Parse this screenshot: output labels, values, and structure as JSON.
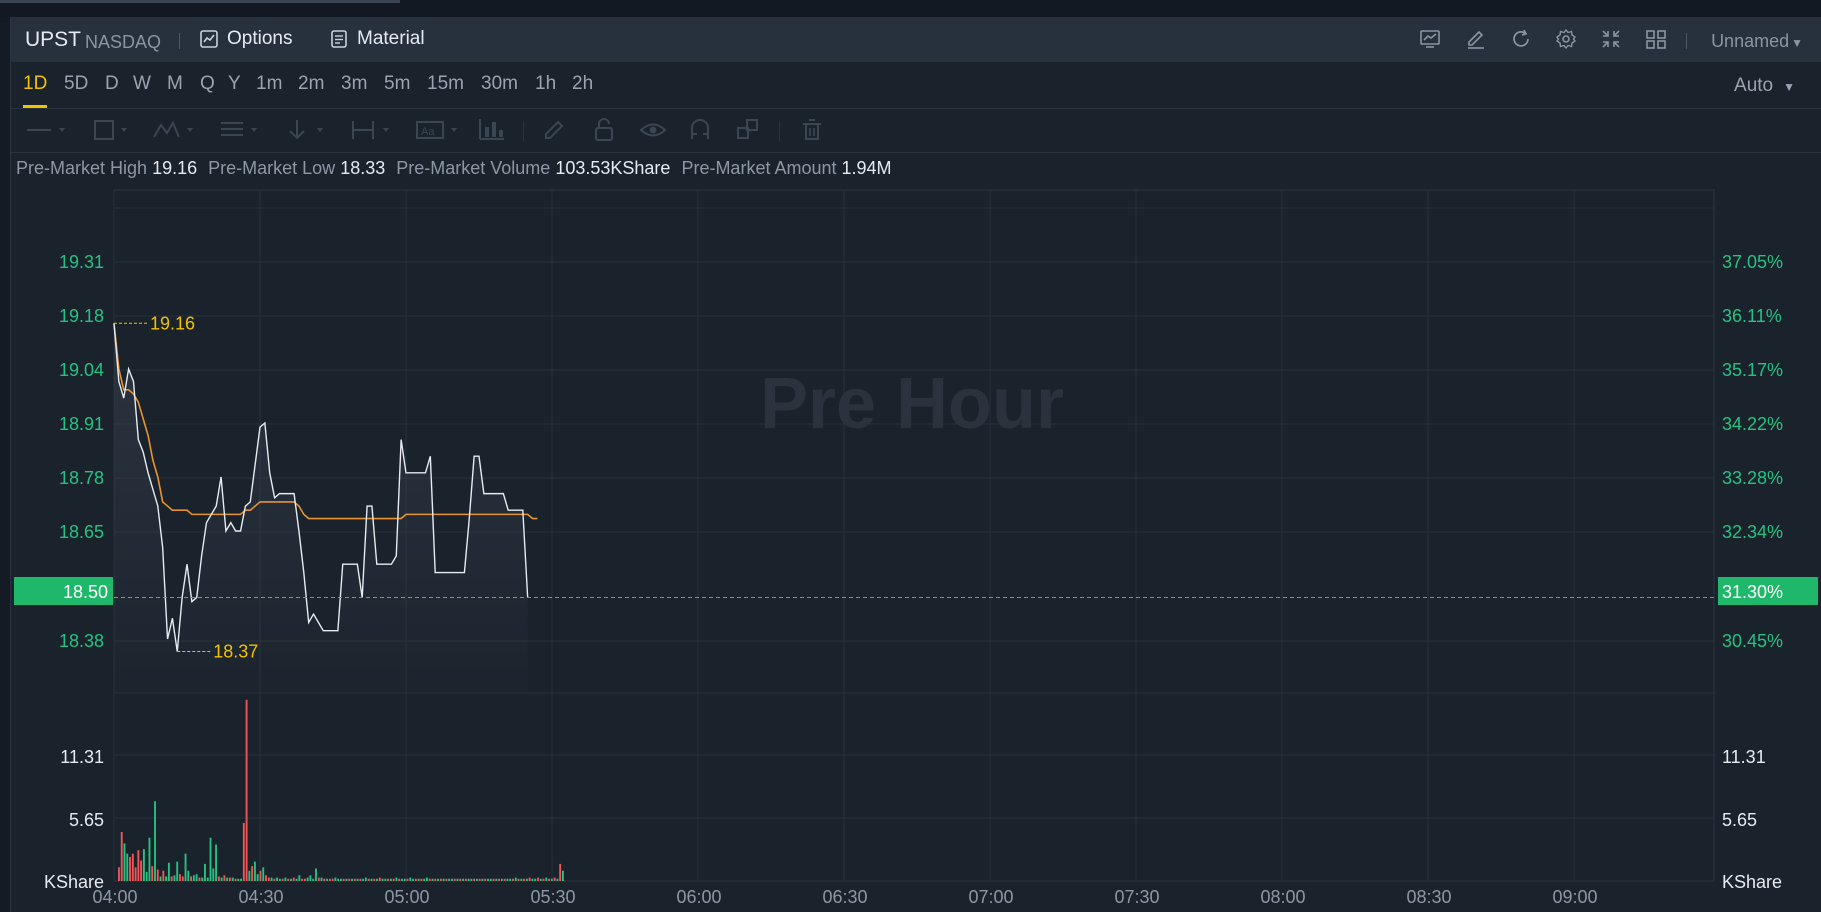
{
  "header": {
    "symbol": "UPST",
    "exchange": "NASDAQ",
    "options_label": "Options",
    "material_label": "Material",
    "workspace_label": "Unnamed"
  },
  "timeframes": [
    "1D",
    "5D",
    "D",
    "W",
    "M",
    "Q",
    "Y",
    "1m",
    "2m",
    "3m",
    "5m",
    "15m",
    "30m",
    "1h",
    "2h"
  ],
  "active_timeframe": "1D",
  "scale_mode": "Auto",
  "info": {
    "high_label": "Pre-Market High",
    "high_value": "19.16",
    "low_label": "Pre-Market Low",
    "low_value": "18.33",
    "volume_label": "Pre-Market Volume",
    "volume_value": "103.53KShare",
    "amount_label": "Pre-Market Amount",
    "amount_value": "1.94M"
  },
  "watermark": "Pre Hour",
  "colors": {
    "up": "#26c281",
    "down": "#f15656",
    "price_line": "#e6ebf1",
    "avg_line": "#e8932f",
    "highlight": "#f2c200",
    "current_bg": "#1fb86b"
  },
  "chart_data": {
    "type": "line",
    "price_axis_left": [
      "19.31",
      "19.18",
      "19.04",
      "18.91",
      "18.78",
      "18.65",
      "18.38"
    ],
    "price_axis_right": [
      "37.05%",
      "36.11%",
      "35.17%",
      "34.22%",
      "33.28%",
      "32.34%",
      "30.45%"
    ],
    "current_price": "18.50",
    "current_change": "31.30%",
    "high_marker": "19.16",
    "low_marker": "18.37",
    "volume_axis": [
      "11.31",
      "5.65"
    ],
    "volume_unit": "KShare",
    "x_ticks": [
      "04:00",
      "04:30",
      "05:00",
      "05:30",
      "06:00",
      "06:30",
      "07:00",
      "07:30",
      "08:00",
      "08:30",
      "09:00"
    ],
    "price_ylim": [
      18.27,
      19.44
    ],
    "price": [
      [
        0,
        19.16
      ],
      [
        1,
        19.02
      ],
      [
        2,
        18.98
      ],
      [
        3,
        19.05
      ],
      [
        4,
        19.02
      ],
      [
        5,
        18.88
      ],
      [
        6,
        18.85
      ],
      [
        7,
        18.8
      ],
      [
        8,
        18.76
      ],
      [
        9,
        18.72
      ],
      [
        10,
        18.62
      ],
      [
        11,
        18.4
      ],
      [
        12,
        18.45
      ],
      [
        13,
        18.37
      ],
      [
        14,
        18.5
      ],
      [
        15,
        18.58
      ],
      [
        16,
        18.49
      ],
      [
        17,
        18.5
      ],
      [
        18,
        18.6
      ],
      [
        19,
        18.68
      ],
      [
        20,
        18.7
      ],
      [
        21,
        18.72
      ],
      [
        22,
        18.79
      ],
      [
        23,
        18.66
      ],
      [
        24,
        18.68
      ],
      [
        25,
        18.66
      ],
      [
        26,
        18.66
      ],
      [
        27,
        18.72
      ],
      [
        28,
        18.73
      ],
      [
        29,
        18.82
      ],
      [
        30,
        18.91
      ],
      [
        31,
        18.92
      ],
      [
        32,
        18.8
      ],
      [
        33,
        18.74
      ],
      [
        34,
        18.75
      ],
      [
        35,
        18.75
      ],
      [
        36,
        18.75
      ],
      [
        37,
        18.75
      ],
      [
        38,
        18.66
      ],
      [
        39,
        18.56
      ],
      [
        40,
        18.44
      ],
      [
        41,
        18.46
      ],
      [
        42,
        18.44
      ],
      [
        43,
        18.42
      ],
      [
        44,
        18.42
      ],
      [
        45,
        18.42
      ],
      [
        46,
        18.42
      ],
      [
        47,
        18.58
      ],
      [
        48,
        18.58
      ],
      [
        49,
        18.58
      ],
      [
        50,
        18.58
      ],
      [
        51,
        18.5
      ],
      [
        52,
        18.72
      ],
      [
        53,
        18.72
      ],
      [
        54,
        18.58
      ],
      [
        55,
        18.58
      ],
      [
        56,
        18.58
      ],
      [
        57,
        18.58
      ],
      [
        58,
        18.6
      ],
      [
        59,
        18.88
      ],
      [
        60,
        18.8
      ],
      [
        61,
        18.8
      ],
      [
        62,
        18.8
      ],
      [
        63,
        18.8
      ],
      [
        64,
        18.8
      ],
      [
        65,
        18.84
      ],
      [
        66,
        18.56
      ],
      [
        67,
        18.56
      ],
      [
        68,
        18.56
      ],
      [
        69,
        18.56
      ],
      [
        70,
        18.56
      ],
      [
        71,
        18.56
      ],
      [
        72,
        18.56
      ],
      [
        73,
        18.69
      ],
      [
        74,
        18.84
      ],
      [
        75,
        18.84
      ],
      [
        76,
        18.75
      ],
      [
        77,
        18.75
      ],
      [
        78,
        18.75
      ],
      [
        79,
        18.75
      ],
      [
        80,
        18.75
      ],
      [
        81,
        18.71
      ],
      [
        82,
        18.71
      ],
      [
        83,
        18.71
      ],
      [
        84,
        18.71
      ],
      [
        85,
        18.5
      ]
    ],
    "avg_price": [
      [
        0,
        19.16
      ],
      [
        1,
        19.05
      ],
      [
        2,
        19.0
      ],
      [
        3,
        19.0
      ],
      [
        4,
        18.99
      ],
      [
        5,
        18.97
      ],
      [
        6,
        18.93
      ],
      [
        7,
        18.89
      ],
      [
        8,
        18.83
      ],
      [
        9,
        18.79
      ],
      [
        10,
        18.73
      ],
      [
        11,
        18.72
      ],
      [
        12,
        18.71
      ],
      [
        13,
        18.71
      ],
      [
        14,
        18.71
      ],
      [
        15,
        18.71
      ],
      [
        16,
        18.7
      ],
      [
        17,
        18.7
      ],
      [
        18,
        18.7
      ],
      [
        19,
        18.7
      ],
      [
        20,
        18.7
      ],
      [
        21,
        18.7
      ],
      [
        22,
        18.7
      ],
      [
        23,
        18.7
      ],
      [
        24,
        18.7
      ],
      [
        25,
        18.7
      ],
      [
        26,
        18.7
      ],
      [
        27,
        18.71
      ],
      [
        28,
        18.71
      ],
      [
        29,
        18.72
      ],
      [
        30,
        18.73
      ],
      [
        31,
        18.73
      ],
      [
        32,
        18.73
      ],
      [
        33,
        18.73
      ],
      [
        34,
        18.73
      ],
      [
        35,
        18.73
      ],
      [
        36,
        18.73
      ],
      [
        37,
        18.73
      ],
      [
        38,
        18.72
      ],
      [
        39,
        18.7
      ],
      [
        40,
        18.69
      ],
      [
        41,
        18.69
      ],
      [
        42,
        18.69
      ],
      [
        43,
        18.69
      ],
      [
        44,
        18.69
      ],
      [
        45,
        18.69
      ],
      [
        46,
        18.69
      ],
      [
        47,
        18.69
      ],
      [
        48,
        18.69
      ],
      [
        49,
        18.69
      ],
      [
        50,
        18.69
      ],
      [
        51,
        18.69
      ],
      [
        52,
        18.69
      ],
      [
        53,
        18.69
      ],
      [
        54,
        18.69
      ],
      [
        55,
        18.69
      ],
      [
        56,
        18.69
      ],
      [
        57,
        18.69
      ],
      [
        58,
        18.69
      ],
      [
        59,
        18.69
      ],
      [
        60,
        18.7
      ],
      [
        61,
        18.7
      ],
      [
        62,
        18.7
      ],
      [
        63,
        18.7
      ],
      [
        64,
        18.7
      ],
      [
        65,
        18.7
      ],
      [
        66,
        18.7
      ],
      [
        67,
        18.7
      ],
      [
        68,
        18.7
      ],
      [
        69,
        18.7
      ],
      [
        70,
        18.7
      ],
      [
        71,
        18.7
      ],
      [
        72,
        18.7
      ],
      [
        73,
        18.7
      ],
      [
        74,
        18.7
      ],
      [
        75,
        18.7
      ],
      [
        76,
        18.7
      ],
      [
        77,
        18.7
      ],
      [
        78,
        18.7
      ],
      [
        79,
        18.7
      ],
      [
        80,
        18.7
      ],
      [
        81,
        18.7
      ],
      [
        82,
        18.7
      ],
      [
        83,
        18.7
      ],
      [
        84,
        18.7
      ],
      [
        85,
        18.7
      ],
      [
        86,
        18.69
      ],
      [
        87,
        18.69
      ]
    ],
    "volume_ylim": [
      0,
      16.5
    ],
    "volume": [
      [
        0,
        1.2,
        "down"
      ],
      [
        1,
        4.3,
        "down"
      ],
      [
        2,
        3.3,
        "up"
      ],
      [
        3,
        2.4,
        "up"
      ],
      [
        4,
        2.1,
        "down"
      ],
      [
        5,
        2.4,
        "down"
      ],
      [
        6,
        1.2,
        "down"
      ],
      [
        7,
        2.7,
        "down"
      ],
      [
        8,
        1.8,
        "down"
      ],
      [
        9,
        2.8,
        "up"
      ],
      [
        10,
        0.8,
        "up"
      ],
      [
        11,
        3.8,
        "up"
      ],
      [
        12,
        1.3,
        "down"
      ],
      [
        13,
        7.0,
        "up"
      ],
      [
        14,
        1.0,
        "down"
      ],
      [
        15,
        0.4,
        "up"
      ],
      [
        16,
        0.9,
        "down"
      ],
      [
        17,
        0.4,
        "up"
      ],
      [
        18,
        1.6,
        "up"
      ],
      [
        19,
        0.4,
        "down"
      ],
      [
        20,
        0.5,
        "up"
      ],
      [
        21,
        1.7,
        "up"
      ],
      [
        22,
        0.6,
        "down"
      ],
      [
        23,
        0.4,
        "down"
      ],
      [
        24,
        2.4,
        "up"
      ],
      [
        25,
        0.9,
        "up"
      ],
      [
        26,
        0.4,
        "down"
      ],
      [
        27,
        0.5,
        "up"
      ],
      [
        28,
        0.6,
        "up"
      ],
      [
        29,
        0.3,
        "down"
      ],
      [
        30,
        0.3,
        "up"
      ],
      [
        31,
        1.5,
        "up"
      ],
      [
        32,
        0.3,
        "up"
      ],
      [
        33,
        3.8,
        "up"
      ],
      [
        34,
        1.1,
        "up"
      ],
      [
        35,
        3.2,
        "up"
      ],
      [
        36,
        0.4,
        "down"
      ],
      [
        37,
        0.3,
        "up"
      ],
      [
        38,
        0.5,
        "down"
      ],
      [
        39,
        0.3,
        "up"
      ],
      [
        40,
        0.3,
        "down"
      ],
      [
        41,
        0.3,
        "up"
      ],
      [
        42,
        0.2,
        "down"
      ],
      [
        43,
        0.2,
        "up"
      ],
      [
        44,
        0.2,
        "up"
      ],
      [
        45,
        5.1,
        "down"
      ],
      [
        46,
        15.9,
        "down"
      ],
      [
        47,
        0.9,
        "up"
      ],
      [
        48,
        1.3,
        "down"
      ],
      [
        49,
        1.7,
        "up"
      ],
      [
        50,
        0.6,
        "up"
      ],
      [
        51,
        0.9,
        "down"
      ],
      [
        52,
        1.2,
        "up"
      ],
      [
        53,
        0.5,
        "down"
      ],
      [
        54,
        0.3,
        "down"
      ],
      [
        55,
        0.3,
        "up"
      ],
      [
        56,
        0.2,
        "down"
      ],
      [
        57,
        0.3,
        "up"
      ],
      [
        58,
        0.2,
        "up"
      ],
      [
        59,
        0.2,
        "down"
      ],
      [
        60,
        0.3,
        "up"
      ],
      [
        61,
        0.2,
        "down"
      ],
      [
        62,
        0.2,
        "up"
      ],
      [
        63,
        0.3,
        "down"
      ],
      [
        64,
        0.2,
        "up"
      ],
      [
        65,
        0.5,
        "up"
      ],
      [
        66,
        0.2,
        "down"
      ],
      [
        67,
        0.2,
        "down"
      ],
      [
        68,
        0.3,
        "up"
      ],
      [
        69,
        0.5,
        "up"
      ],
      [
        70,
        0.2,
        "up"
      ],
      [
        71,
        1.1,
        "up"
      ],
      [
        72,
        0.3,
        "down"
      ],
      [
        73,
        0.3,
        "up"
      ],
      [
        74,
        0.2,
        "down"
      ],
      [
        75,
        0.2,
        "up"
      ],
      [
        76,
        0.2,
        "down"
      ],
      [
        77,
        0.2,
        "down"
      ],
      [
        78,
        0.3,
        "up"
      ],
      [
        79,
        0.2,
        "up"
      ],
      [
        80,
        0.2,
        "up"
      ],
      [
        81,
        0.2,
        "down"
      ],
      [
        82,
        0.2,
        "up"
      ],
      [
        83,
        0.2,
        "down"
      ],
      [
        84,
        0.2,
        "up"
      ],
      [
        85,
        0.2,
        "down"
      ],
      [
        86,
        0.2,
        "up"
      ],
      [
        87,
        0.2,
        "down"
      ],
      [
        88,
        0.2,
        "up"
      ],
      [
        89,
        0.3,
        "up"
      ],
      [
        90,
        0.2,
        "down"
      ],
      [
        91,
        0.2,
        "up"
      ],
      [
        92,
        0.2,
        "down"
      ],
      [
        93,
        0.2,
        "up"
      ],
      [
        94,
        0.3,
        "down"
      ],
      [
        95,
        0.2,
        "up"
      ],
      [
        96,
        0.2,
        "up"
      ],
      [
        97,
        0.2,
        "down"
      ],
      [
        98,
        0.2,
        "up"
      ],
      [
        99,
        0.2,
        "down"
      ],
      [
        100,
        0.3,
        "up"
      ],
      [
        101,
        0.2,
        "down"
      ],
      [
        102,
        0.2,
        "up"
      ],
      [
        103,
        0.2,
        "up"
      ],
      [
        104,
        0.2,
        "down"
      ],
      [
        105,
        0.3,
        "up"
      ],
      [
        106,
        0.2,
        "up"
      ],
      [
        107,
        0.2,
        "down"
      ],
      [
        108,
        0.2,
        "up"
      ],
      [
        109,
        0.2,
        "down"
      ],
      [
        110,
        0.2,
        "up"
      ],
      [
        111,
        0.3,
        "up"
      ],
      [
        112,
        0.2,
        "down"
      ],
      [
        113,
        0.2,
        "up"
      ],
      [
        114,
        0.2,
        "down"
      ],
      [
        115,
        0.2,
        "up"
      ],
      [
        116,
        0.2,
        "down"
      ],
      [
        117,
        0.2,
        "up"
      ],
      [
        118,
        0.2,
        "down"
      ],
      [
        119,
        0.2,
        "up"
      ],
      [
        120,
        0.2,
        "up"
      ],
      [
        121,
        0.2,
        "down"
      ],
      [
        122,
        0.2,
        "up"
      ],
      [
        123,
        0.2,
        "down"
      ],
      [
        124,
        0.2,
        "up"
      ],
      [
        125,
        0.2,
        "down"
      ],
      [
        126,
        0.2,
        "up"
      ],
      [
        127,
        0.2,
        "up"
      ],
      [
        128,
        0.2,
        "down"
      ],
      [
        129,
        0.2,
        "up"
      ],
      [
        130,
        0.2,
        "down"
      ],
      [
        131,
        0.2,
        "up"
      ],
      [
        132,
        0.2,
        "down"
      ],
      [
        133,
        0.2,
        "up"
      ],
      [
        134,
        0.2,
        "up"
      ],
      [
        135,
        0.2,
        "down"
      ],
      [
        136,
        0.2,
        "up"
      ],
      [
        137,
        0.2,
        "down"
      ],
      [
        138,
        0.2,
        "up"
      ],
      [
        139,
        0.2,
        "down"
      ],
      [
        140,
        0.2,
        "up"
      ],
      [
        141,
        0.2,
        "up"
      ],
      [
        142,
        0.2,
        "down"
      ],
      [
        143,
        0.3,
        "up"
      ],
      [
        144,
        0.2,
        "down"
      ],
      [
        145,
        0.2,
        "up"
      ],
      [
        146,
        0.2,
        "down"
      ],
      [
        147,
        0.2,
        "up"
      ],
      [
        148,
        0.3,
        "down"
      ],
      [
        149,
        0.2,
        "up"
      ],
      [
        150,
        0.2,
        "up"
      ],
      [
        151,
        0.3,
        "down"
      ],
      [
        152,
        0.2,
        "up"
      ],
      [
        153,
        0.2,
        "down"
      ],
      [
        154,
        0.3,
        "up"
      ],
      [
        155,
        0.2,
        "down"
      ],
      [
        156,
        0.2,
        "up"
      ],
      [
        157,
        0.3,
        "down"
      ],
      [
        158,
        0.2,
        "up"
      ],
      [
        159,
        1.5,
        "down"
      ],
      [
        160,
        0.9,
        "up"
      ]
    ]
  }
}
